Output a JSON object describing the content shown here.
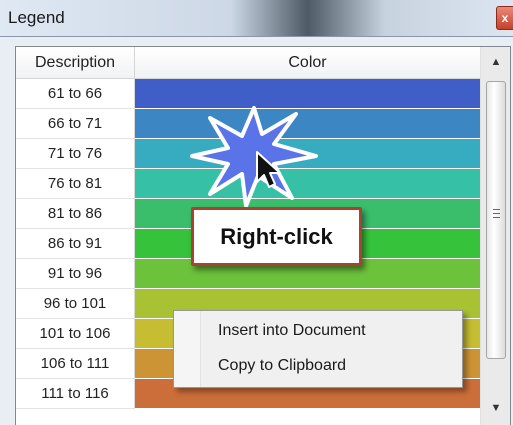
{
  "window": {
    "title": "Legend",
    "close_glyph": "x"
  },
  "table": {
    "headers": {
      "description": "Description",
      "color": "Color"
    },
    "rows": [
      {
        "description": "61 to 66",
        "color": "#3f5ec8"
      },
      {
        "description": "66 to 71",
        "color": "#3c86c4"
      },
      {
        "description": "71 to 76",
        "color": "#37acc0"
      },
      {
        "description": "76 to 81",
        "color": "#36c1a6"
      },
      {
        "description": "81 to 86",
        "color": "#3abe6c"
      },
      {
        "description": "86 to 91",
        "color": "#36c23a"
      },
      {
        "description": "91 to 96",
        "color": "#6cc23a"
      },
      {
        "description": "96 to 101",
        "color": "#a8c234"
      },
      {
        "description": "101 to 106",
        "color": "#c6bd33"
      },
      {
        "description": "106 to 111",
        "color": "#cc9434"
      },
      {
        "description": "111 to 116",
        "color": "#cc6e39"
      }
    ]
  },
  "scrollbar": {
    "up_icon": "arrow-up-icon",
    "down_icon": "arrow-down-icon"
  },
  "annotation": {
    "label": "Right-click",
    "burst_color": "#5b73e8"
  },
  "context_menu": {
    "items": [
      {
        "label": "Insert into Document"
      },
      {
        "label": "Copy to Clipboard"
      }
    ]
  }
}
